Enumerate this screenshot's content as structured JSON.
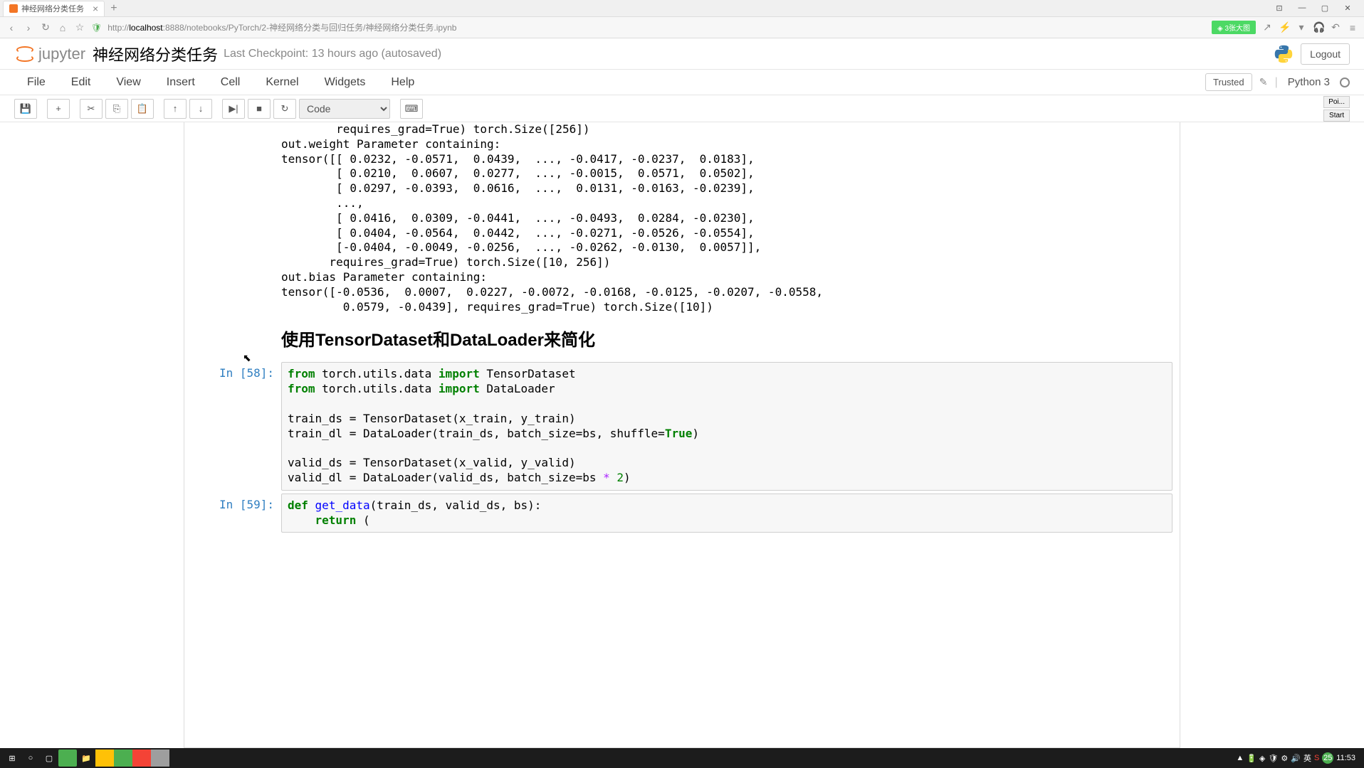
{
  "browser": {
    "tab_title": "神经网络分类任务",
    "url_prefix": "http://",
    "url_host": "localhost",
    "url_rest": ":8888/notebooks/PyTorch/2-神经网络分类与回归任务/神经网络分类任务.ipynb",
    "green_badge": "◈ 3张大图"
  },
  "header": {
    "logo_text": "jupyter",
    "notebook_title": "神经网络分类任务",
    "checkpoint": "Last Checkpoint: 13 hours ago (autosaved)",
    "logout": "Logout"
  },
  "menu": {
    "items": [
      "File",
      "Edit",
      "View",
      "Insert",
      "Cell",
      "Kernel",
      "Widgets",
      "Help"
    ],
    "trusted": "Trusted",
    "kernel": "Python 3"
  },
  "toolbar": {
    "cell_type": "Code",
    "poi": "Poi...",
    "start": "Start"
  },
  "output": "        requires_grad=True) torch.Size([256])\nout.weight Parameter containing:\ntensor([[ 0.0232, -0.0571,  0.0439,  ..., -0.0417, -0.0237,  0.0183],\n        [ 0.0210,  0.0607,  0.0277,  ..., -0.0015,  0.0571,  0.0502],\n        [ 0.0297, -0.0393,  0.0616,  ...,  0.0131, -0.0163, -0.0239],\n        ...,\n        [ 0.0416,  0.0309, -0.0441,  ..., -0.0493,  0.0284, -0.0230],\n        [ 0.0404, -0.0564,  0.0442,  ..., -0.0271, -0.0526, -0.0554],\n        [-0.0404, -0.0049, -0.0256,  ..., -0.0262, -0.0130,  0.0057]],\n       requires_grad=True) torch.Size([10, 256])\nout.bias Parameter containing:\ntensor([-0.0536,  0.0007,  0.0227, -0.0072, -0.0168, -0.0125, -0.0207, -0.0558,\n         0.0579, -0.0439], requires_grad=True) torch.Size([10])",
  "markdown_heading": "使用TensorDataset和DataLoader来简化",
  "cells": [
    {
      "prompt": "In [58]:",
      "code_html": "<span class='kw-green'>from</span> torch.utils.data <span class='kw-green'>import</span> TensorDataset\n<span class='kw-green'>from</span> torch.utils.data <span class='kw-green'>import</span> DataLoader\n\ntrain_ds = TensorDataset(x_train, y_train)\ntrain_dl = DataLoader(train_ds, batch_size=bs, shuffle=<span class='kw-green'>True</span>)\n\nvalid_ds = TensorDataset(x_valid, y_valid)\nvalid_dl = DataLoader(valid_ds, batch_size=bs <span class='op'>*</span> <span class='num'>2</span>)"
    },
    {
      "prompt": "In [59]:",
      "code_html": "<span class='kw-green'>def</span> <span class='kw-blue'>get_data</span>(train_ds, valid_ds, bs):\n    <span class='kw-green'>return</span> ("
    }
  ],
  "taskbar": {
    "time": "11:53",
    "badge": "25",
    "lang": "英"
  }
}
